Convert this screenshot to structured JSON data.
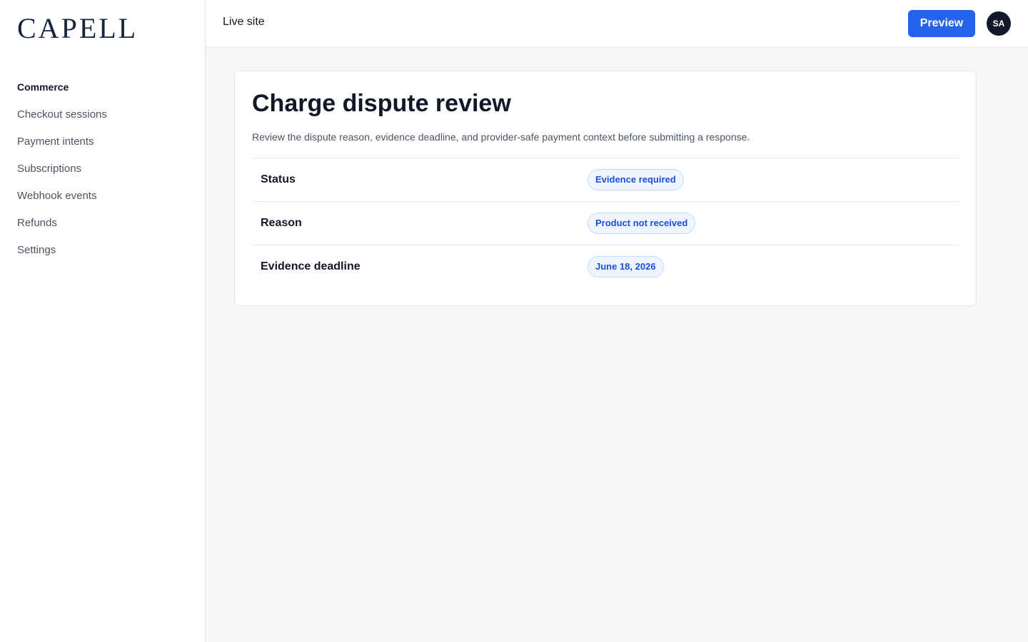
{
  "app": {
    "logo": "CAPELL"
  },
  "sidebar": {
    "section": "Commerce",
    "items": [
      {
        "label": "Checkout sessions"
      },
      {
        "label": "Payment intents"
      },
      {
        "label": "Subscriptions"
      },
      {
        "label": "Webhook events"
      },
      {
        "label": "Refunds"
      },
      {
        "label": "Settings"
      }
    ]
  },
  "header": {
    "site_label": "Live site",
    "preview_label": "Preview",
    "avatar_initials": "SA"
  },
  "main": {
    "title": "Charge dispute review",
    "description": "Review the dispute reason, evidence deadline, and provider-safe payment context before submitting a response.",
    "rows": [
      {
        "label": "Status",
        "value": "Evidence required"
      },
      {
        "label": "Reason",
        "value": "Product not received"
      },
      {
        "label": "Evidence deadline",
        "value": "June 18, 2026"
      }
    ]
  },
  "colors": {
    "accent": "#2563eb",
    "badge_text": "#1d4ed8",
    "badge_bg": "#eff6ff",
    "logo": "#15233f"
  }
}
